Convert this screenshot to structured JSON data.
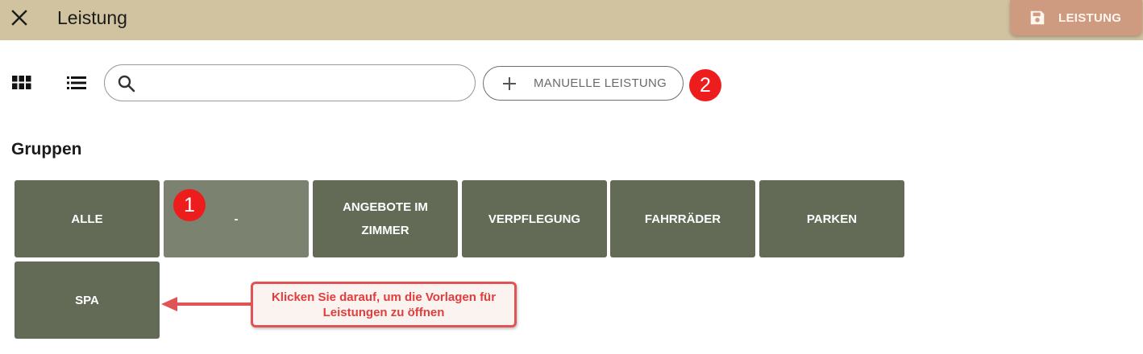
{
  "header": {
    "title": "Leistung",
    "save_button_label": "LEISTUNG",
    "colors": {
      "bar": "#d1c3a0",
      "save_button": "#cf9b80"
    }
  },
  "toolbar": {
    "grid_view_icon": "grid-view-icon",
    "list_view_icon": "list-view-icon",
    "search_value": "",
    "search_placeholder": "",
    "manual_button_label": "MANUELLE LEISTUNG"
  },
  "badges": {
    "one": "1",
    "two": "2"
  },
  "groups": {
    "title": "Gruppen",
    "items": [
      {
        "label": "ALLE"
      },
      {
        "label": "-"
      },
      {
        "label": "ANGEBOTE IM ZIMMER"
      },
      {
        "label": "VERPFLEGUNG"
      },
      {
        "label": "FAHRRÄDER"
      },
      {
        "label": "PARKEN"
      },
      {
        "label": "SPA"
      }
    ],
    "selected_index": 1,
    "colors": {
      "tile": "#636b56",
      "tile_selected": "#7b8270"
    }
  },
  "callout": {
    "text": "Klicken Sie darauf, um die Vorlagen für Leistungen zu öffnen",
    "color": "#e23c3c"
  }
}
